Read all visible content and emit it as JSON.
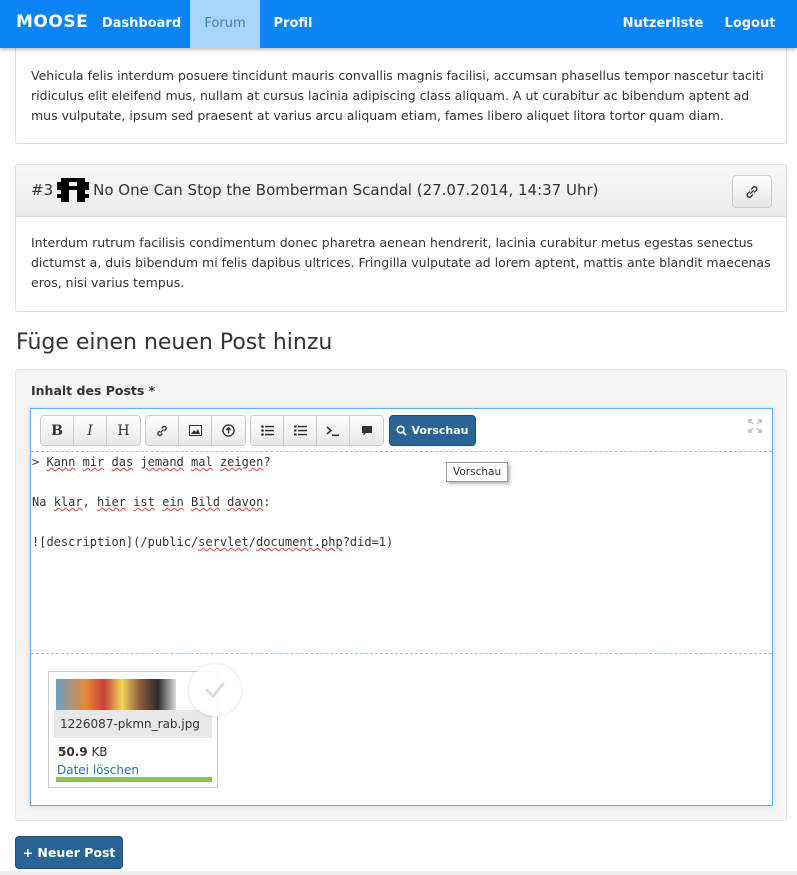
{
  "navbar": {
    "brand": "MOOSE",
    "items": [
      {
        "label": "Dashboard",
        "active": false
      },
      {
        "label": "Forum",
        "active": true
      },
      {
        "label": "Profil",
        "active": false
      }
    ],
    "right_items": [
      {
        "label": "Nutzerliste"
      },
      {
        "label": "Logout"
      }
    ],
    "color": "#0c84f4"
  },
  "posts": [
    {
      "body": "Vehicula felis interdum posuere tincidunt mauris convallis magnis facilisi, accumsan phasellus tempor nascetur taciti ridiculus elit eleifend mus, nullam at cursus lacinia adipiscing class aliquam. A ut curabitur ac bibendum aptent ad mus vulputate, ipsum sed praesent at varius arcu aliquam etiam, fames libero aliquet litora tortor quam diam."
    },
    {
      "number": "#3",
      "title": "No One Can Stop the Bomberman Scandal (27.07.2014, 14:37 Uhr)",
      "body": "Interdum rutrum facilisis condimentum donec pharetra aenean hendrerit, lacinia curabitur metus egestas senectus dictumst a, duis bibendum mi felis dapibus ultrices. Fringilla vulputate ad lorem aptent, mattis ante blandit maecenas eros, nisi varius tempus."
    }
  ],
  "new_post": {
    "heading": "Füge einen neuen Post hinzu",
    "label": "Inhalt des Posts *",
    "preview_button": "Vorschau",
    "tooltip": "Vorschau",
    "content_lines": [
      "> Kann mir das jemand mal zeigen?",
      "",
      "Na klar, hier ist ein Bild davon:",
      "",
      "![description](/public/servlet/document.php?did=1)"
    ],
    "file": {
      "name": "1226087-pkmn_rab.jpg",
      "size_value": "50.9",
      "size_unit": "KB",
      "delete_label": "Datei löschen",
      "progress": 1.0
    },
    "submit_button": "+ Neuer Post"
  }
}
